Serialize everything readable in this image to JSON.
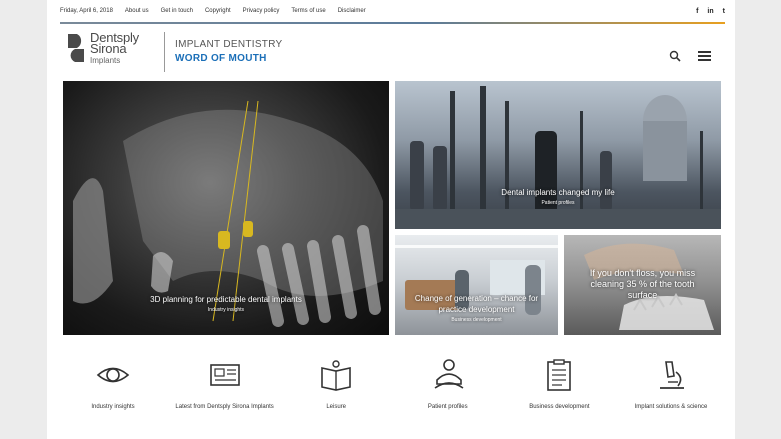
{
  "topbar": {
    "date": "Friday, April 6, 2018",
    "links": [
      "About us",
      "Get in touch",
      "Copyright",
      "Privacy policy",
      "Terms of use",
      "Disclaimer"
    ],
    "social": [
      {
        "icon": "facebook-icon",
        "glyph": "f"
      },
      {
        "icon": "linkedin-icon",
        "glyph": "in"
      },
      {
        "icon": "twitter-icon",
        "glyph": "t"
      }
    ]
  },
  "brand": {
    "line1": "Dentsply",
    "line2": "Sirona",
    "line3": "Implants"
  },
  "tagline": {
    "line1": "IMPLANT DENTISTRY",
    "line2": "WORD OF MOUTH",
    "accent": "#1b6fb8"
  },
  "tiles": {
    "big": {
      "title": "3D planning for predictable dental implants",
      "category": "Industry insights"
    },
    "paris": {
      "title": "Dental implants changed my life",
      "category": "Patient profiles"
    },
    "office": {
      "title": "Change of generation – chance for practice development",
      "category": "Business development"
    },
    "floss": {
      "title": "If you don't floss, you miss cleaning 35 % of the tooth surface",
      "category": ""
    }
  },
  "categories": [
    {
      "icon": "eye-icon",
      "label": "Industry insights"
    },
    {
      "icon": "newspaper-icon",
      "label": "Latest from Dentsply Sirona Implants"
    },
    {
      "icon": "book-icon",
      "label": "Leisure"
    },
    {
      "icon": "people-icon",
      "label": "Patient profiles"
    },
    {
      "icon": "clipboard-icon",
      "label": "Business development"
    },
    {
      "icon": "microscope-icon",
      "label": "Implant solutions & science"
    }
  ]
}
